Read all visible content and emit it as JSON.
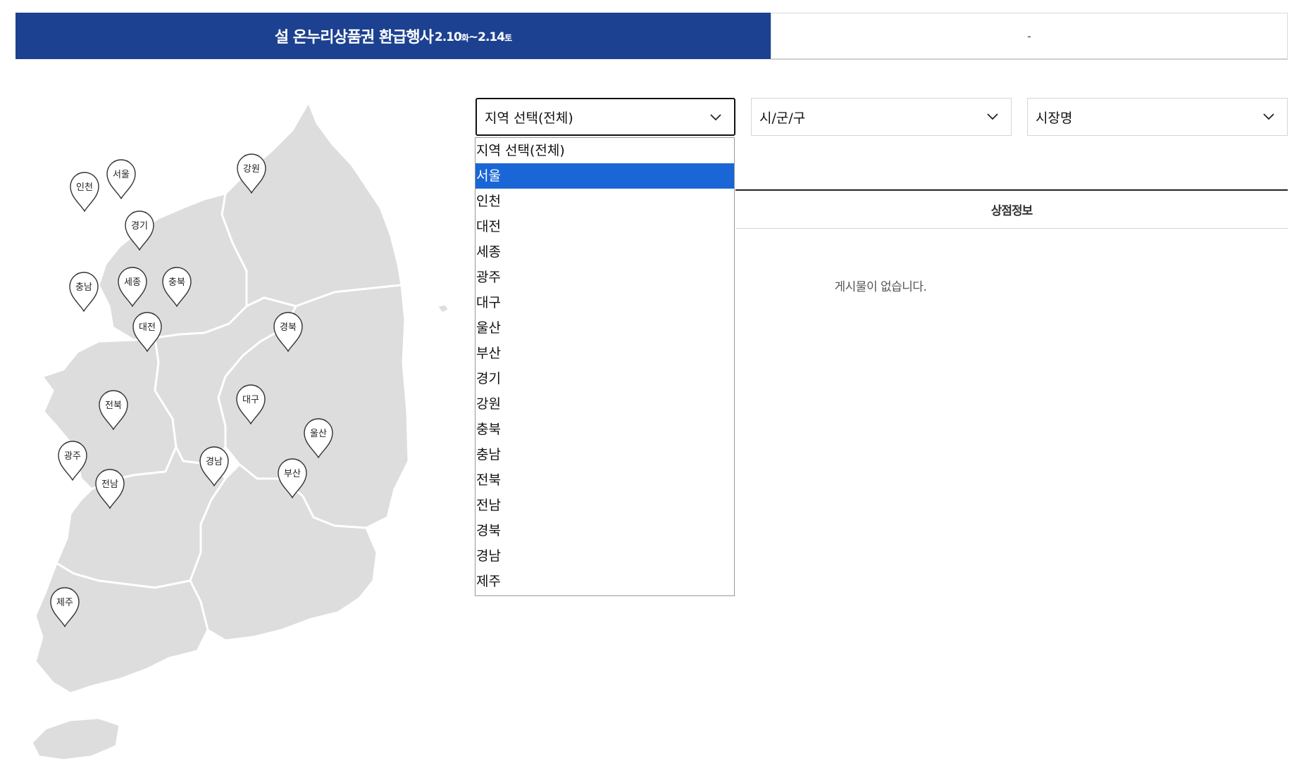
{
  "tabs": {
    "active_title": "설 온누리상품권 환급행사",
    "active_date_start": "2.10",
    "active_date_start_day": "화",
    "active_date_sep": "~",
    "active_date_end": "2.14",
    "active_date_end_day": "토",
    "inactive_label": "-"
  },
  "map": {
    "land_color": "#dddddd",
    "border_color": "#ffffff",
    "pins": [
      {
        "label": "서울"
      },
      {
        "label": "인천"
      },
      {
        "label": "강원"
      },
      {
        "label": "경기"
      },
      {
        "label": "충남"
      },
      {
        "label": "세종"
      },
      {
        "label": "충북"
      },
      {
        "label": "대전"
      },
      {
        "label": "경북"
      },
      {
        "label": "전북"
      },
      {
        "label": "대구"
      },
      {
        "label": "울산"
      },
      {
        "label": "광주"
      },
      {
        "label": "경남"
      },
      {
        "label": "부산"
      },
      {
        "label": "전남"
      },
      {
        "label": "제주"
      }
    ]
  },
  "filters": {
    "region_value": "지역 선택(전체)",
    "city_value": "시/군/구",
    "market_value": "시장명"
  },
  "dropdown": {
    "options": [
      "지역 선택(전체)",
      "서울",
      "인천",
      "대전",
      "세종",
      "광주",
      "대구",
      "울산",
      "부산",
      "경기",
      "강원",
      "충북",
      "충남",
      "전북",
      "전남",
      "경북",
      "경남",
      "제주"
    ],
    "highlighted": "서울",
    "highlight_color": "#1a66d6"
  },
  "table": {
    "header": "상점정보",
    "empty_message": "게시물이 없습니다."
  },
  "colors": {
    "tab_active_bg": "#1c4190"
  }
}
